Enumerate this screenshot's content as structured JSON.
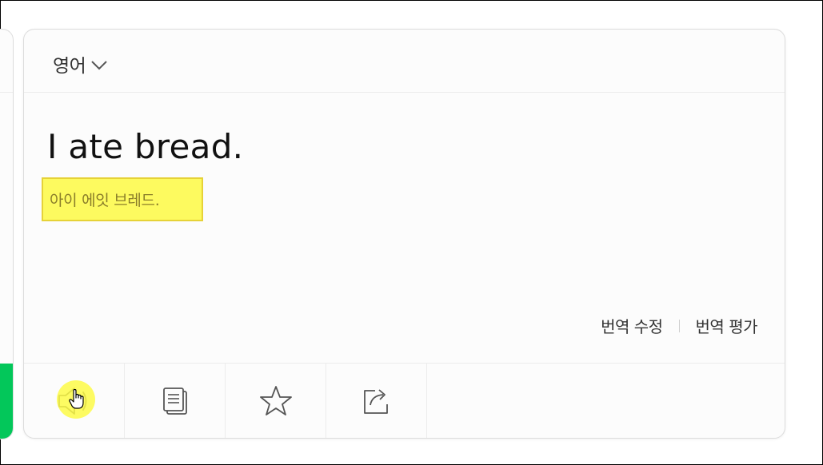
{
  "source_language": "영어",
  "output": {
    "text": "I ate bread.",
    "pronunciation": "아이 에잇 브레드."
  },
  "links": {
    "edit_translation": "번역 수정",
    "rate_translation": "번역 평가"
  },
  "toolbar": {
    "icons": [
      "speaker-icon",
      "copy-icon",
      "star-icon",
      "share-icon"
    ]
  },
  "colors": {
    "accent_green": "#03c75a",
    "highlight_yellow": "#fdfa5f"
  }
}
